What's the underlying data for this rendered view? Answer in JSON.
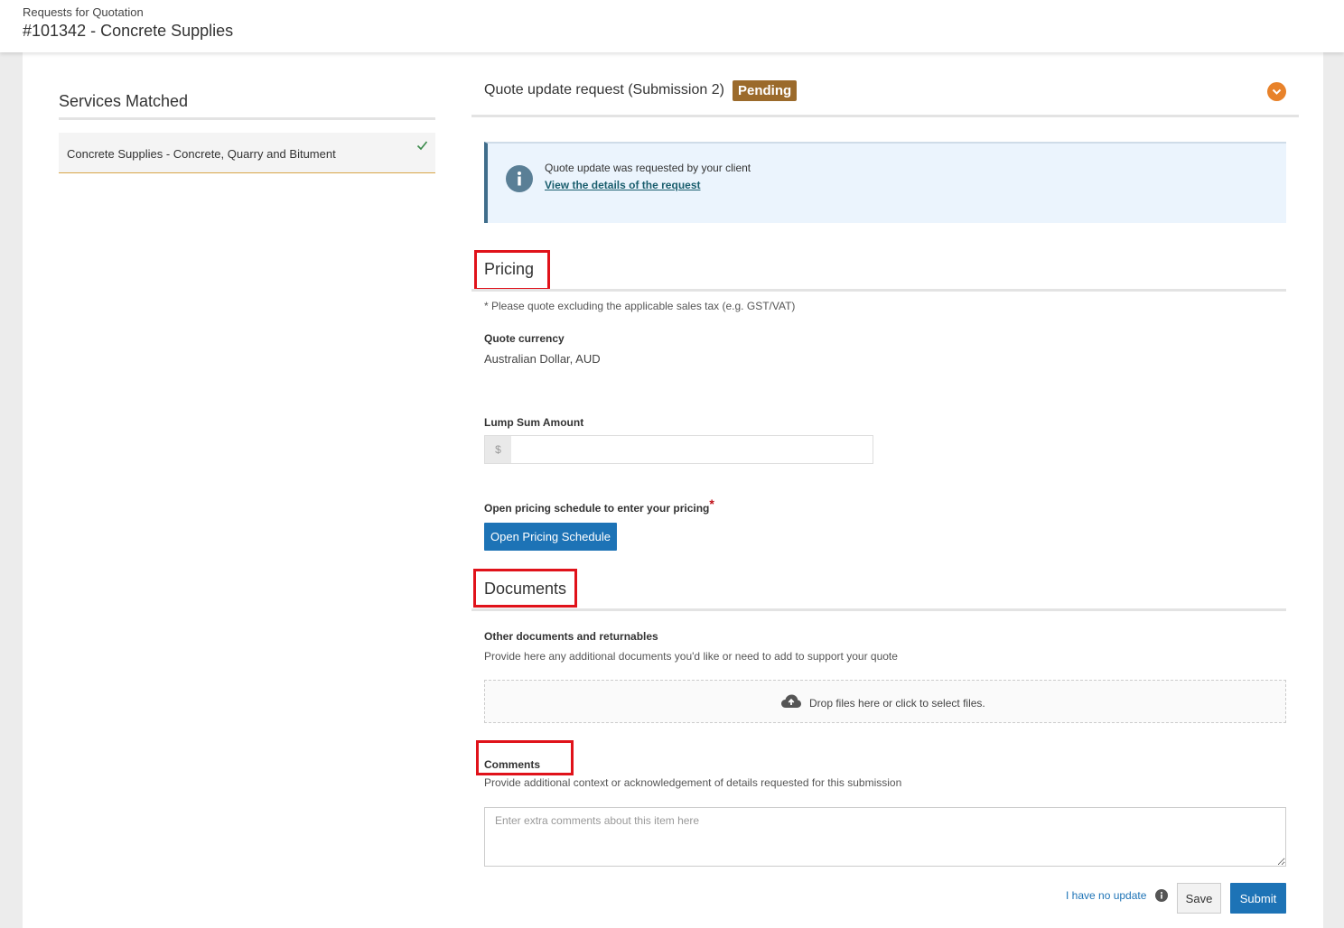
{
  "header": {
    "breadcrumb": "Requests for Quotation",
    "title": "#101342 - Concrete Supplies"
  },
  "sidebar": {
    "title": "Services Matched",
    "items": [
      {
        "label": "Concrete Supplies - Concrete, Quarry and Bitument",
        "selected": true
      }
    ]
  },
  "submission": {
    "title": "Quote update request (Submission 2)",
    "status": "Pending",
    "status_color": "#9b6a2b",
    "accent_color": "#e8822a"
  },
  "info": {
    "text": "Quote update was requested by your client",
    "link": "View the details of the request"
  },
  "pricing": {
    "title": "Pricing",
    "note": "* Please quote excluding the applicable sales tax (e.g. GST/VAT)",
    "currency_label": "Quote currency",
    "currency_value": "Australian Dollar, AUD",
    "lump_sum_label": "Lump Sum Amount",
    "lump_sum_prefix": "$",
    "lump_sum_value": "",
    "schedule_label": "Open pricing schedule to enter your pricing",
    "schedule_button": "Open Pricing Schedule"
  },
  "documents": {
    "title": "Documents",
    "other_label": "Other documents and returnables",
    "other_help": "Provide here any additional documents you'd like or need to add to support your quote",
    "dropzone_text": "Drop files here or click to select files."
  },
  "comments": {
    "label": "Comments",
    "help": "Provide additional context or acknowledgement of details requested for this submission",
    "placeholder": "Enter extra comments about this item here"
  },
  "actions": {
    "no_update": "I have no update",
    "save": "Save",
    "submit": "Submit"
  },
  "colors": {
    "primary": "#1d73b6",
    "highlight_box": "#e0121a"
  }
}
